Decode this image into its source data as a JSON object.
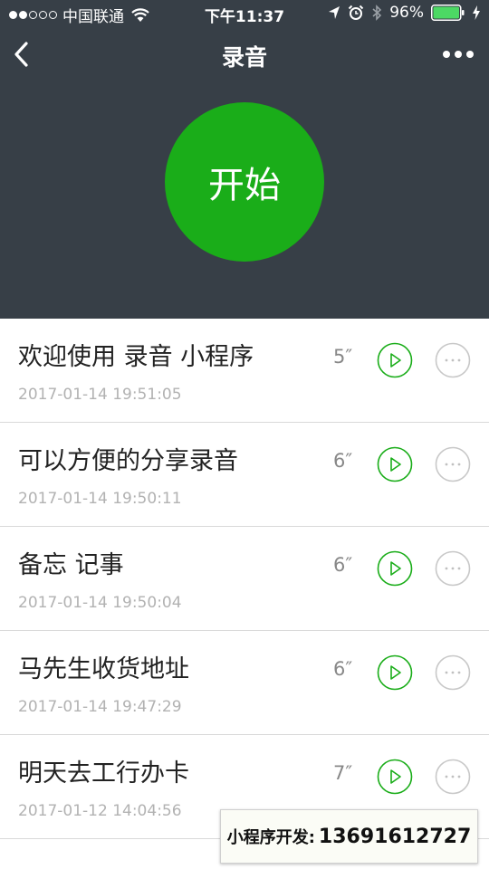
{
  "status_bar": {
    "carrier": "中国联通",
    "time": "下午11:37",
    "battery": "96%"
  },
  "nav": {
    "title": "录音"
  },
  "start_button": {
    "label": "开始"
  },
  "recordings": [
    {
      "title": "欢迎使用 录音 小程序",
      "timestamp": "2017-01-14 19:51:05",
      "duration": "5″"
    },
    {
      "title": "可以方便的分享录音",
      "timestamp": "2017-01-14 19:50:11",
      "duration": "6″"
    },
    {
      "title": "备忘 记事",
      "timestamp": "2017-01-14 19:50:04",
      "duration": "6″"
    },
    {
      "title": "马先生收货地址",
      "timestamp": "2017-01-14 19:47:29",
      "duration": "6″"
    },
    {
      "title": "明天去工行办卡",
      "timestamp": "2017-01-12 14:04:56",
      "duration": "7″"
    }
  ],
  "watermark": {
    "label": "小程序开发:",
    "phone": "13691612727"
  },
  "colors": {
    "header_bg": "#373f47",
    "accent_green": "#1aad19",
    "battery_green": "#4cd964"
  }
}
